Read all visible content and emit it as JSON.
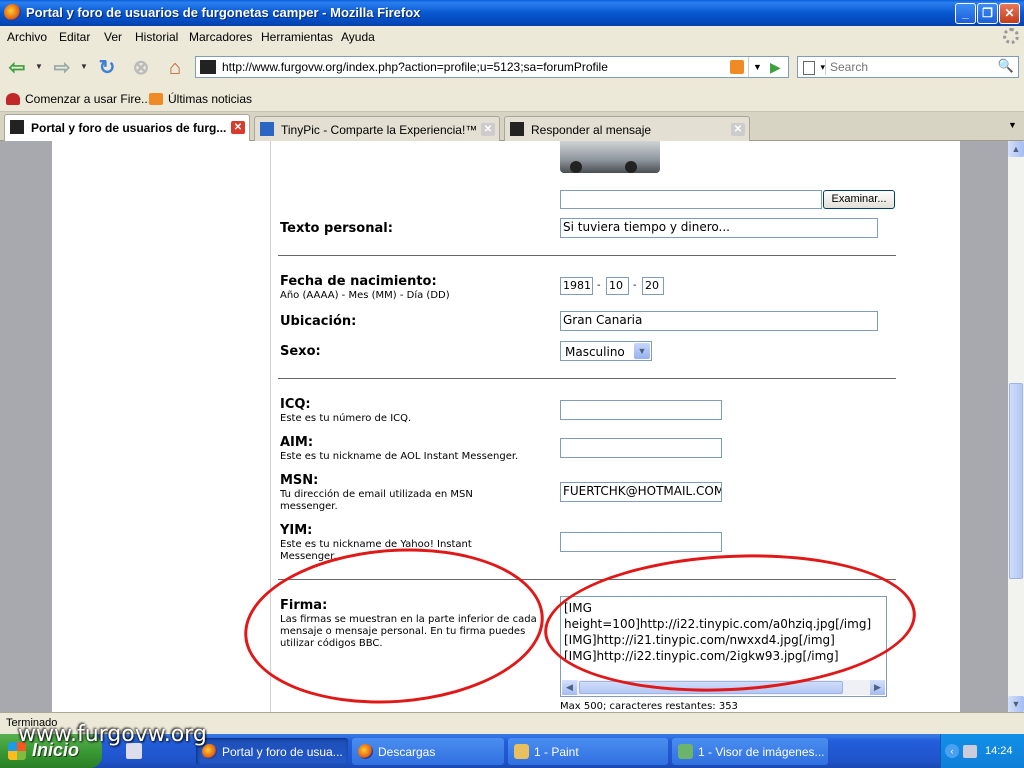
{
  "window": {
    "title": "Portal y foro de usuarios de furgonetas camper - Mozilla Firefox"
  },
  "menu": [
    "Archivo",
    "Editar",
    "Ver",
    "Historial",
    "Marcadores",
    "Herramientas",
    "Ayuda"
  ],
  "nav": {
    "url": "http://www.furgovw.org/index.php?action=profile;u=5123;sa=forumProfile",
    "search_placeholder": "Search"
  },
  "bookmarks": [
    "Comenzar a usar Fire...",
    "Últimas noticias"
  ],
  "tabs": [
    {
      "label": "Portal y foro de usuarios de furg...",
      "active": true
    },
    {
      "label": "TinyPic - Comparte la Experiencia!™",
      "active": false
    },
    {
      "label": "Responder al mensaje",
      "active": false
    }
  ],
  "form": {
    "browse_button": "Examinar...",
    "personal_text_label": "Texto personal:",
    "personal_text_value": "Si tuviera tiempo y dinero...",
    "birthdate_label": "Fecha de nacimiento:",
    "birthdate_hint": "Año (AAAA) - Mes (MM) - Día (DD)",
    "birth_year": "1981",
    "birth_month": "10",
    "birth_day": "20",
    "date_sep": "-",
    "location_label": "Ubicación:",
    "location_value": "Gran Canaria",
    "gender_label": "Sexo:",
    "gender_value": "Masculino",
    "icq_label": "ICQ:",
    "icq_hint": "Este es tu número de ICQ.",
    "aim_label": "AIM:",
    "aim_hint": "Este es tu nickname de AOL Instant Messenger.",
    "msn_label": "MSN:",
    "msn_hint": "Tu dirección de email utilizada en MSN messenger.",
    "msn_value": "FUERTCHK@HOTMAIL.COM",
    "yim_label": "YIM:",
    "yim_hint": "Este es tu nickname de Yahoo! Instant Messenger.",
    "signature_label": "Firma:",
    "signature_hint": "Las firmas se muestran en la parte inferior de cada mensaje o mensaje personal. En tu firma puedes utilizar códigos BBC.",
    "signature_lines": [
      "[IMG",
      "height=100]http://i22.tinypic.com/a0hziq.jpg[/img]",
      "[IMG]http://i21.tinypic.com/nwxxd4.jpg[/img]",
      "[IMG]http://i22.tinypic.com/2igkw93.jpg[/img]"
    ],
    "signature_counter": "Max 500; caracteres restantes: 353"
  },
  "status": {
    "text": "Terminado"
  },
  "taskbar": {
    "start_label": "Inicio",
    "tasks": [
      "Portal y foro de usua...",
      "Descargas",
      "1 - Paint",
      "1 - Visor de imágenes..."
    ],
    "clock": "14:24"
  },
  "watermark": "www.furgovw.org",
  "colors": {
    "highlight_ellipse": "#e01818",
    "titlebar": "#0858d0"
  }
}
